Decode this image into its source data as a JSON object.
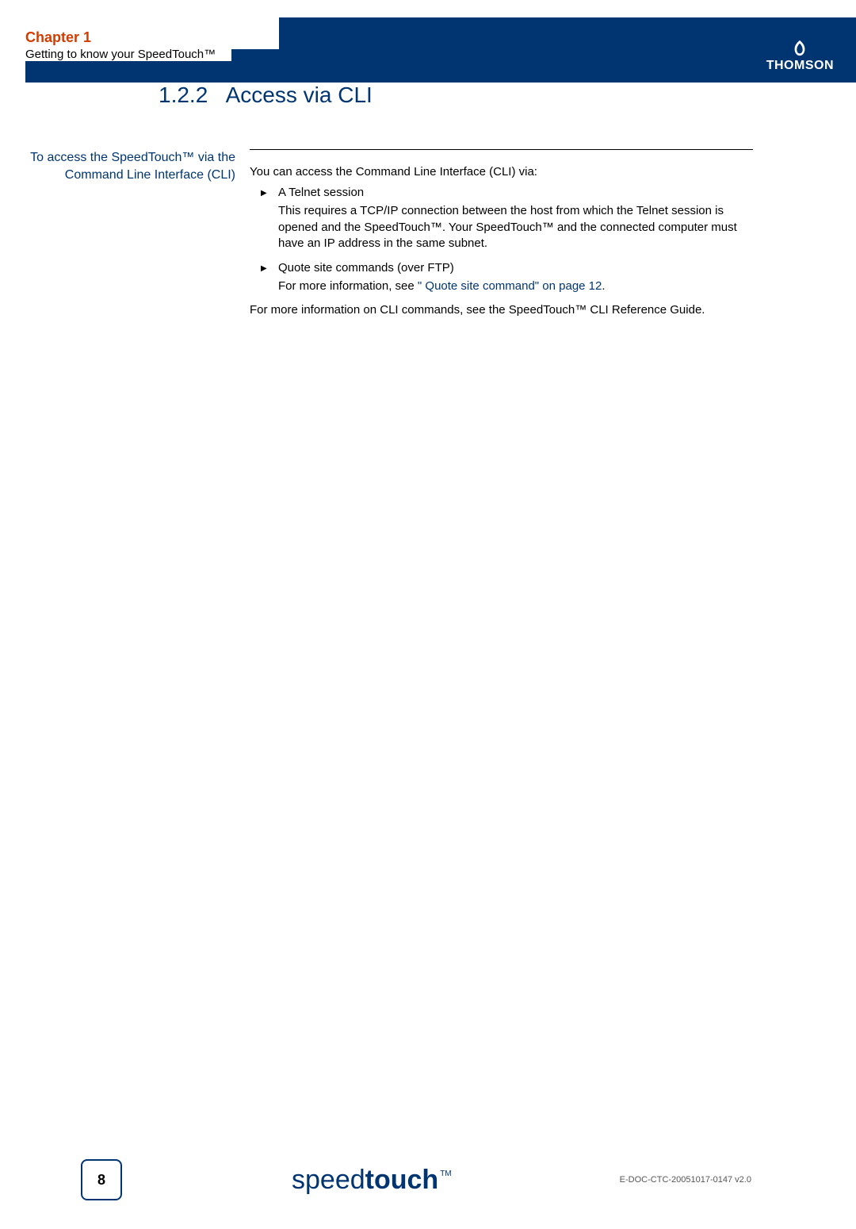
{
  "header": {
    "chapter": "Chapter 1",
    "subtitle": "Getting to know your SpeedTouch™",
    "brand": "THOMSON"
  },
  "section": {
    "number": "1.2.2",
    "title": "Access via CLI",
    "sideHeading": "To access the SpeedTouch™ via the Command Line Interface (CLI)"
  },
  "body": {
    "intro": "You can access the Command Line Interface (CLI) via:",
    "bullets": [
      {
        "title": "A Telnet session",
        "body": "This requires a TCP/IP connection between the host from which the Telnet session is opened and the SpeedTouch™. Your SpeedTouch™ and the connected computer must have an IP address in the same subnet."
      },
      {
        "title": "Quote site commands (over FTP)",
        "moreInfoPrefix": "For more information, see ",
        "xref": "\" Quote site command\" on page 12",
        "moreInfoSuffix": "."
      }
    ],
    "outro": "For more information on CLI commands, see the SpeedTouch™ CLI Reference Guide."
  },
  "footer": {
    "page": "8",
    "logoPrefix": "speed",
    "logoBold": "touch",
    "logoTm": "TM",
    "docId": "E-DOC-CTC-20051017-0147 v2.0"
  }
}
